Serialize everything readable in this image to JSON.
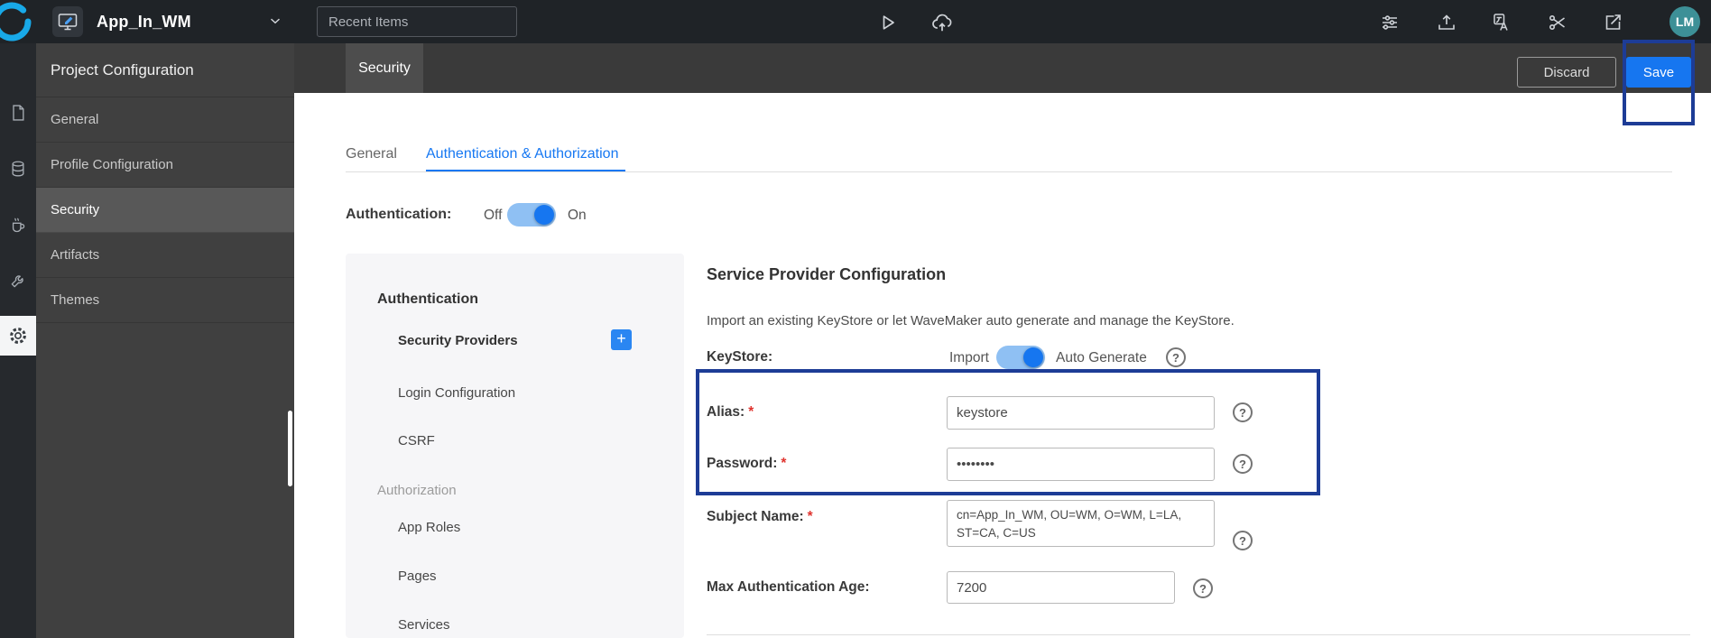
{
  "topbar": {
    "app_title": "App_In_WM",
    "recent_items_placeholder": "Recent Items",
    "avatar_initials": "LM"
  },
  "sidebar": {
    "title": "Project Configuration",
    "items": [
      {
        "label": "General"
      },
      {
        "label": "Profile Configuration"
      },
      {
        "label": "Security",
        "selected": true
      },
      {
        "label": "Artifacts"
      },
      {
        "label": "Themes"
      }
    ]
  },
  "page_header": {
    "active_tab": "Security",
    "discard_label": "Discard",
    "save_label": "Save"
  },
  "content_tabs": {
    "general": "General",
    "auth_authz": "Authentication & Authorization"
  },
  "authentication_toggle": {
    "label": "Authentication:",
    "off_label": "Off",
    "on_label": "On",
    "state": "on"
  },
  "security_nav": {
    "authentication_section": "Authentication",
    "security_providers": "Security Providers",
    "add_provider_glyph": "+",
    "login_configuration": "Login Configuration",
    "csrf": "CSRF",
    "authorization_section": "Authorization",
    "app_roles": "App Roles",
    "pages": "Pages",
    "services": "Services"
  },
  "service_provider": {
    "title": "Service Provider Configuration",
    "description": "Import an existing KeyStore or let WaveMaker auto generate and manage the KeyStore.",
    "keystore": {
      "label": "KeyStore:",
      "import_label": "Import",
      "auto_generate_label": "Auto Generate",
      "state": "auto-generate"
    },
    "fields": {
      "alias": {
        "label": "Alias:",
        "required": "*",
        "value": "keystore"
      },
      "password": {
        "label": "Password:",
        "required": "*",
        "value": "••••••••"
      },
      "subject_name": {
        "label": "Subject Name:",
        "required": "*",
        "value": "cn=App_In_WM, OU=WM, O=WM, L=LA, ST=CA, C=US"
      },
      "max_auth_age": {
        "label": "Max Authentication Age:",
        "value": "7200"
      }
    },
    "help_glyph": "?"
  },
  "colors": {
    "accent_blue": "#1676f0",
    "annotation_border": "#1d3c96",
    "avatar_teal": "#3d9097",
    "topbar_bg": "#1f2327",
    "sidebar_bg": "#404040"
  }
}
